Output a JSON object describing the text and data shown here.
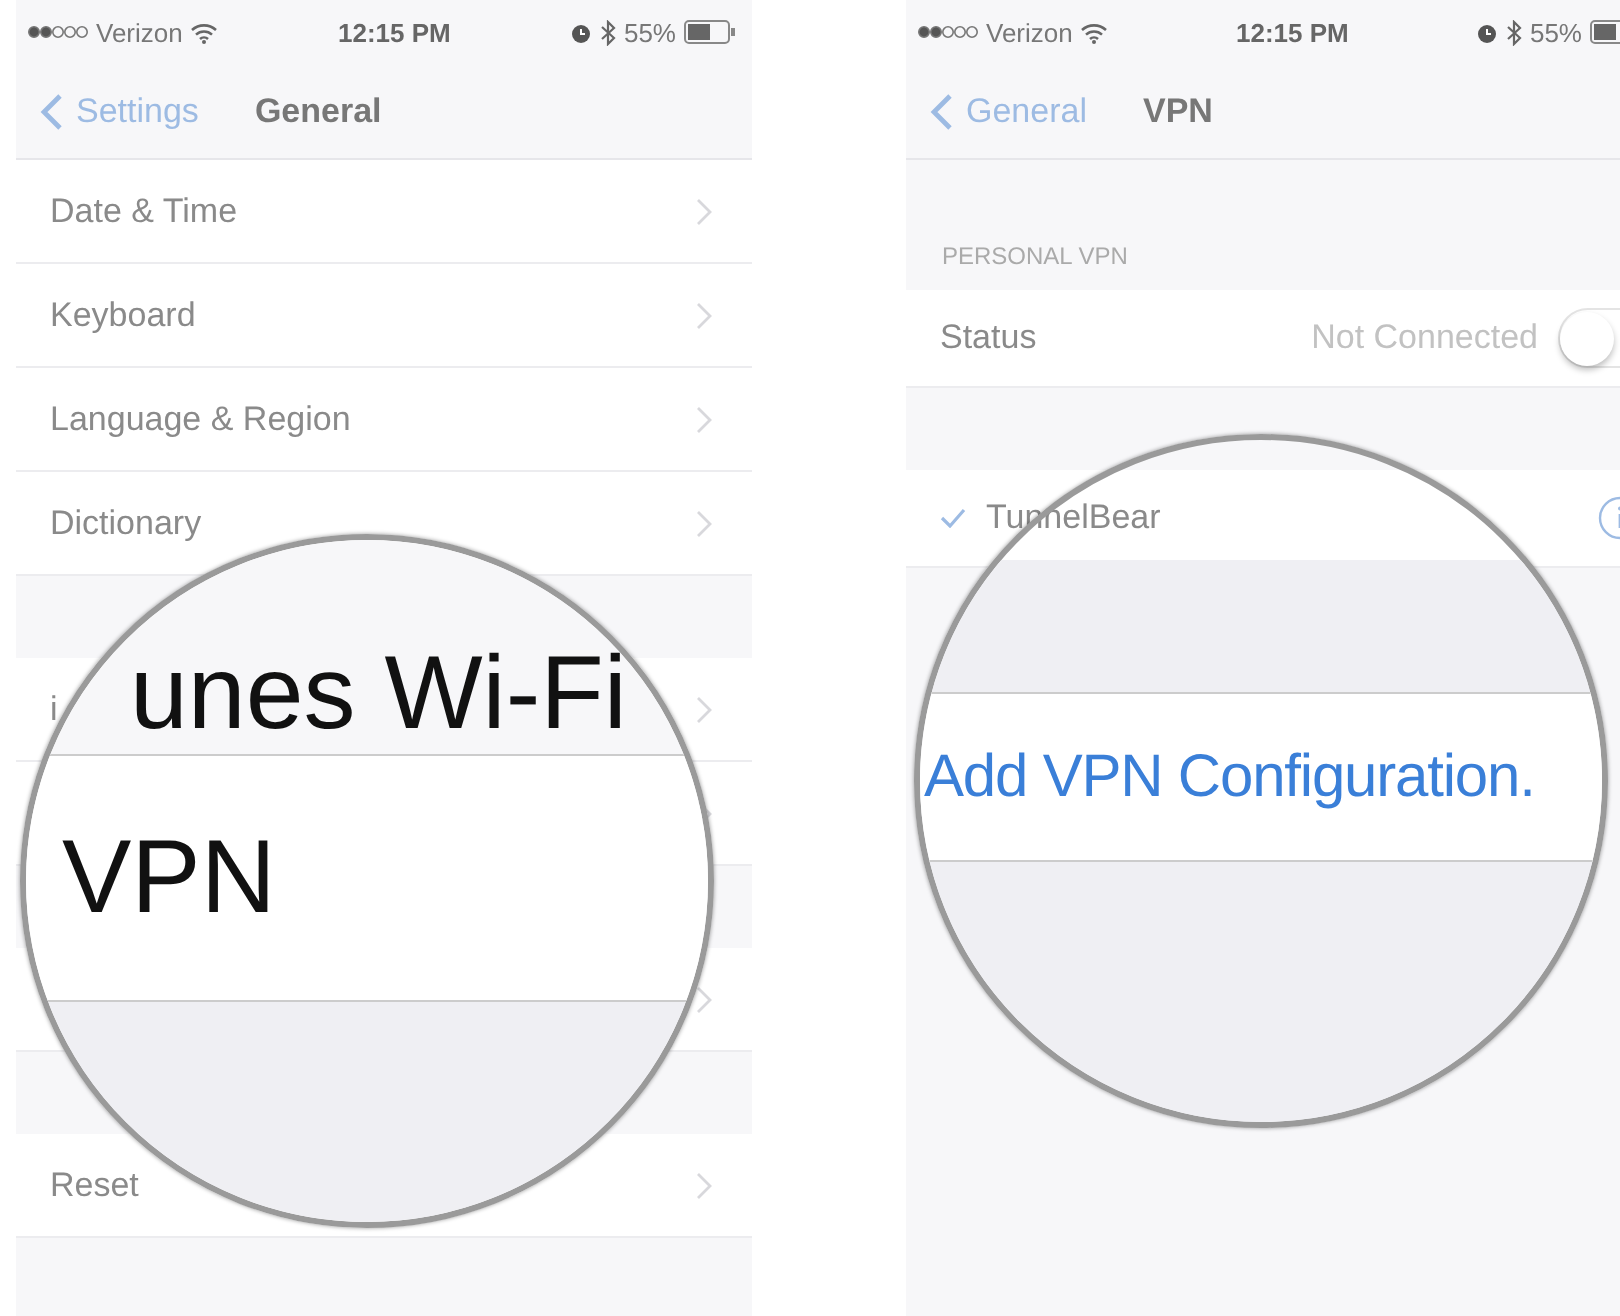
{
  "screens": [
    {
      "status_bar": {
        "carrier": "Verizon",
        "time": "12:15 PM",
        "battery": "55%"
      },
      "nav": {
        "back": "Settings",
        "title": "General"
      },
      "groups": [
        {
          "rows": [
            {
              "kind": "link",
              "label": "Date & Time"
            },
            {
              "kind": "link",
              "label": "Keyboard"
            },
            {
              "kind": "link",
              "label": "Language & Region"
            },
            {
              "kind": "link",
              "label": "Dictionary"
            }
          ]
        },
        {
          "rows": [
            {
              "kind": "link",
              "label": "i"
            },
            {
              "kind": "link"
            }
          ]
        },
        {
          "rows": [
            {
              "kind": "link"
            }
          ]
        },
        {
          "rows": [
            {
              "kind": "link",
              "label": "Reset"
            }
          ]
        }
      ],
      "magnifier": {
        "kind": "setting",
        "top_text": "unes Wi-Fi",
        "main_text": "VPN"
      }
    },
    {
      "status_bar": {
        "carrier": "Verizon",
        "time": "12:15 PM",
        "battery": "55%"
      },
      "nav": {
        "back": "General",
        "title": "VPN"
      },
      "groups": [
        {
          "header": "PERSONAL VPN",
          "rows": [
            {
              "kind": "toggle",
              "label": "Status",
              "value": "Not Connected",
              "on": false
            }
          ]
        },
        {
          "rows": [
            {
              "kind": "config",
              "label": "TunnelBear",
              "selected": true
            }
          ]
        }
      ],
      "magnifier": {
        "kind": "action",
        "main_text": "Add VPN Configuration."
      }
    }
  ]
}
